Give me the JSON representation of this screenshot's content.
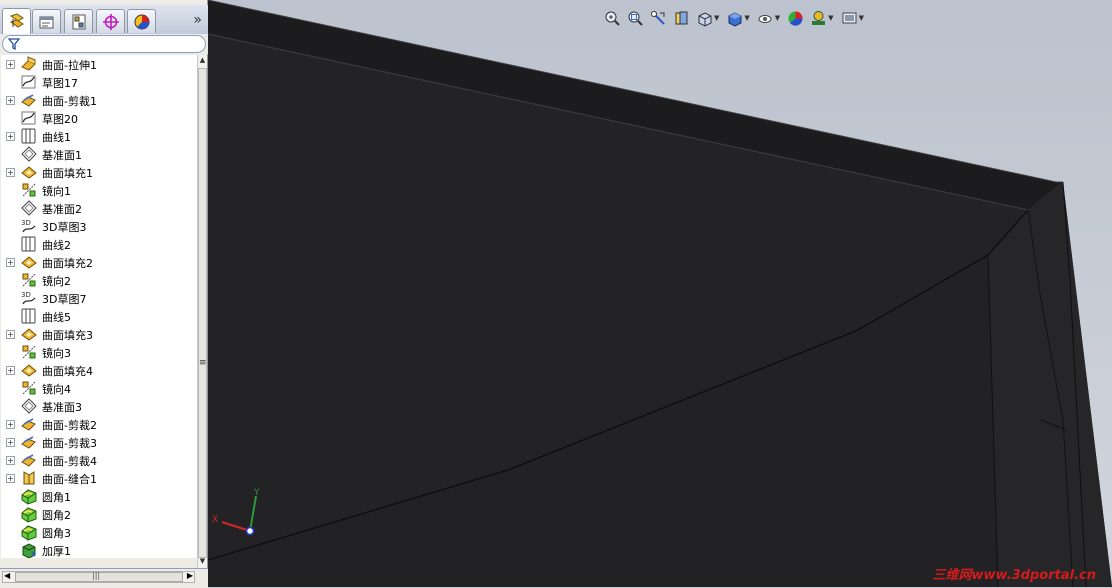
{
  "panel": {
    "tabs": [
      {
        "name": "featuremanager-tab",
        "icon": "feature-tree-icon",
        "active": true
      },
      {
        "name": "propertymanager-tab",
        "icon": "property-manager-icon",
        "active": false
      },
      {
        "name": "configurationmanager-tab",
        "icon": "configuration-manager-icon",
        "active": false
      },
      {
        "name": "dimxpert-tab",
        "icon": "dimxpert-crosshair-icon",
        "active": false
      },
      {
        "name": "display-manager-tab",
        "icon": "display-manager-pie-icon",
        "active": false
      }
    ],
    "expand_chevron": "»",
    "filter_icon": "filter-funnel-icon"
  },
  "tree": [
    {
      "label": "曲面-拉伸1",
      "icon": "surface-extrude-icon",
      "expandable": true
    },
    {
      "label": "草图17",
      "icon": "sketch-icon",
      "expandable": false
    },
    {
      "label": "曲面-剪裁1",
      "icon": "surface-trim-icon",
      "expandable": true
    },
    {
      "label": "草图20",
      "icon": "sketch-icon",
      "expandable": false
    },
    {
      "label": "曲线1",
      "icon": "curve-icon",
      "expandable": true
    },
    {
      "label": "基准面1",
      "icon": "plane-icon",
      "expandable": false
    },
    {
      "label": "曲面填充1",
      "icon": "surface-fill-icon",
      "expandable": true
    },
    {
      "label": "镜向1",
      "icon": "mirror-icon",
      "expandable": false
    },
    {
      "label": "基准面2",
      "icon": "plane-icon",
      "expandable": false
    },
    {
      "label": "3D草图3",
      "icon": "sketch-3d-icon",
      "expandable": false
    },
    {
      "label": "曲线2",
      "icon": "curve-icon",
      "expandable": false
    },
    {
      "label": "曲面填充2",
      "icon": "surface-fill-icon",
      "expandable": true
    },
    {
      "label": "镜向2",
      "icon": "mirror-icon",
      "expandable": false
    },
    {
      "label": "3D草图7",
      "icon": "sketch-3d-icon",
      "expandable": false
    },
    {
      "label": "曲线5",
      "icon": "curve-icon",
      "expandable": false
    },
    {
      "label": "曲面填充3",
      "icon": "surface-fill-icon",
      "expandable": true
    },
    {
      "label": "镜向3",
      "icon": "mirror-icon",
      "expandable": false
    },
    {
      "label": "曲面填充4",
      "icon": "surface-fill-icon",
      "expandable": true
    },
    {
      "label": "镜向4",
      "icon": "mirror-icon",
      "expandable": false
    },
    {
      "label": "基准面3",
      "icon": "plane-icon",
      "expandable": false
    },
    {
      "label": "曲面-剪裁2",
      "icon": "surface-trim-icon",
      "expandable": true
    },
    {
      "label": "曲面-剪裁3",
      "icon": "surface-trim-icon",
      "expandable": true
    },
    {
      "label": "曲面-剪裁4",
      "icon": "surface-trim-icon",
      "expandable": true
    },
    {
      "label": "曲面-缝合1",
      "icon": "surface-knit-icon",
      "expandable": true
    },
    {
      "label": "圆角1",
      "icon": "fillet-icon",
      "expandable": false
    },
    {
      "label": "圆角2",
      "icon": "fillet-icon",
      "expandable": false
    },
    {
      "label": "圆角3",
      "icon": "fillet-icon",
      "expandable": false
    },
    {
      "label": "加厚1",
      "icon": "thicken-icon",
      "expandable": false
    }
  ],
  "hud": [
    {
      "name": "zoom-to-fit-button",
      "icon": "zoom-fit-icon",
      "dropdown": false
    },
    {
      "name": "zoom-to-area-button",
      "icon": "zoom-area-icon",
      "dropdown": false
    },
    {
      "name": "previous-view-button",
      "icon": "previous-view-icon",
      "dropdown": false
    },
    {
      "name": "section-view-button",
      "icon": "section-view-icon",
      "dropdown": false
    },
    {
      "name": "view-orientation-button",
      "icon": "view-orientation-icon",
      "dropdown": true
    },
    {
      "name": "display-style-button",
      "icon": "display-style-cube-icon",
      "dropdown": true
    },
    {
      "name": "hide-show-items-button",
      "icon": "hide-show-icon",
      "dropdown": true
    },
    {
      "name": "edit-appearance-button",
      "icon": "appearance-sphere-icon",
      "dropdown": false
    },
    {
      "name": "apply-scene-button",
      "icon": "scene-icon",
      "dropdown": true
    },
    {
      "name": "view-settings-button",
      "icon": "view-settings-icon",
      "dropdown": true
    }
  ],
  "triad": {
    "x_label": "X",
    "y_label": "Y"
  },
  "watermark": "三维网www.3dportal.cn",
  "colors": {
    "model": "#222224",
    "model_edge": "#0e0e10",
    "viewport_top": "#bcc3ce",
    "watermark": "#d21c1c",
    "axis_x": "#d0282a",
    "axis_y": "#2a9a3a",
    "axis_z": "#2a3ad0"
  }
}
